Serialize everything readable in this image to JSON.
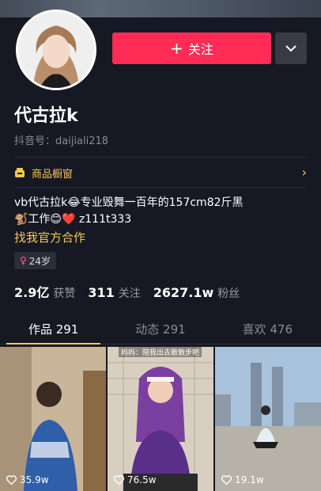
{
  "profile": {
    "name": "代古拉k",
    "douyin_id": "抖音号：daijiali218"
  },
  "actions": {
    "follow_label": "关注",
    "follow_plus": "+"
  },
  "shop": {
    "label": "商品橱窗"
  },
  "bio": {
    "line1": "vb代古拉k😂专业毁舞一百年的157cm82斤黑",
    "line2": "🐒工作😊❤️ z111t333",
    "cooperate": "找我官方合作"
  },
  "age_tag": {
    "symbol": "♀",
    "label": "24岁"
  },
  "stats": {
    "likes_num": "2.9亿",
    "likes_label": "获赞",
    "following_num": "311",
    "following_label": "关注",
    "fans_num": "2627.1w",
    "fans_label": "粉丝"
  },
  "tabs": [
    {
      "label": "作品 291",
      "active": true
    },
    {
      "label": "动态 291",
      "active": false
    },
    {
      "label": "喜欢 476",
      "active": false
    }
  ],
  "videos": [
    {
      "likes": "35.9w",
      "overlay": ""
    },
    {
      "likes": "76.5w",
      "overlay": "妈妈：陪我出去散散步吧"
    },
    {
      "likes": "19.1w",
      "overlay": ""
    }
  ],
  "colors": {
    "accent": "#fe2c55",
    "gold": "#f5c851",
    "background": "#161823"
  },
  "icons": [
    "chevron-down-icon",
    "shop-icon",
    "chevron-right-icon",
    "heart-icon"
  ]
}
